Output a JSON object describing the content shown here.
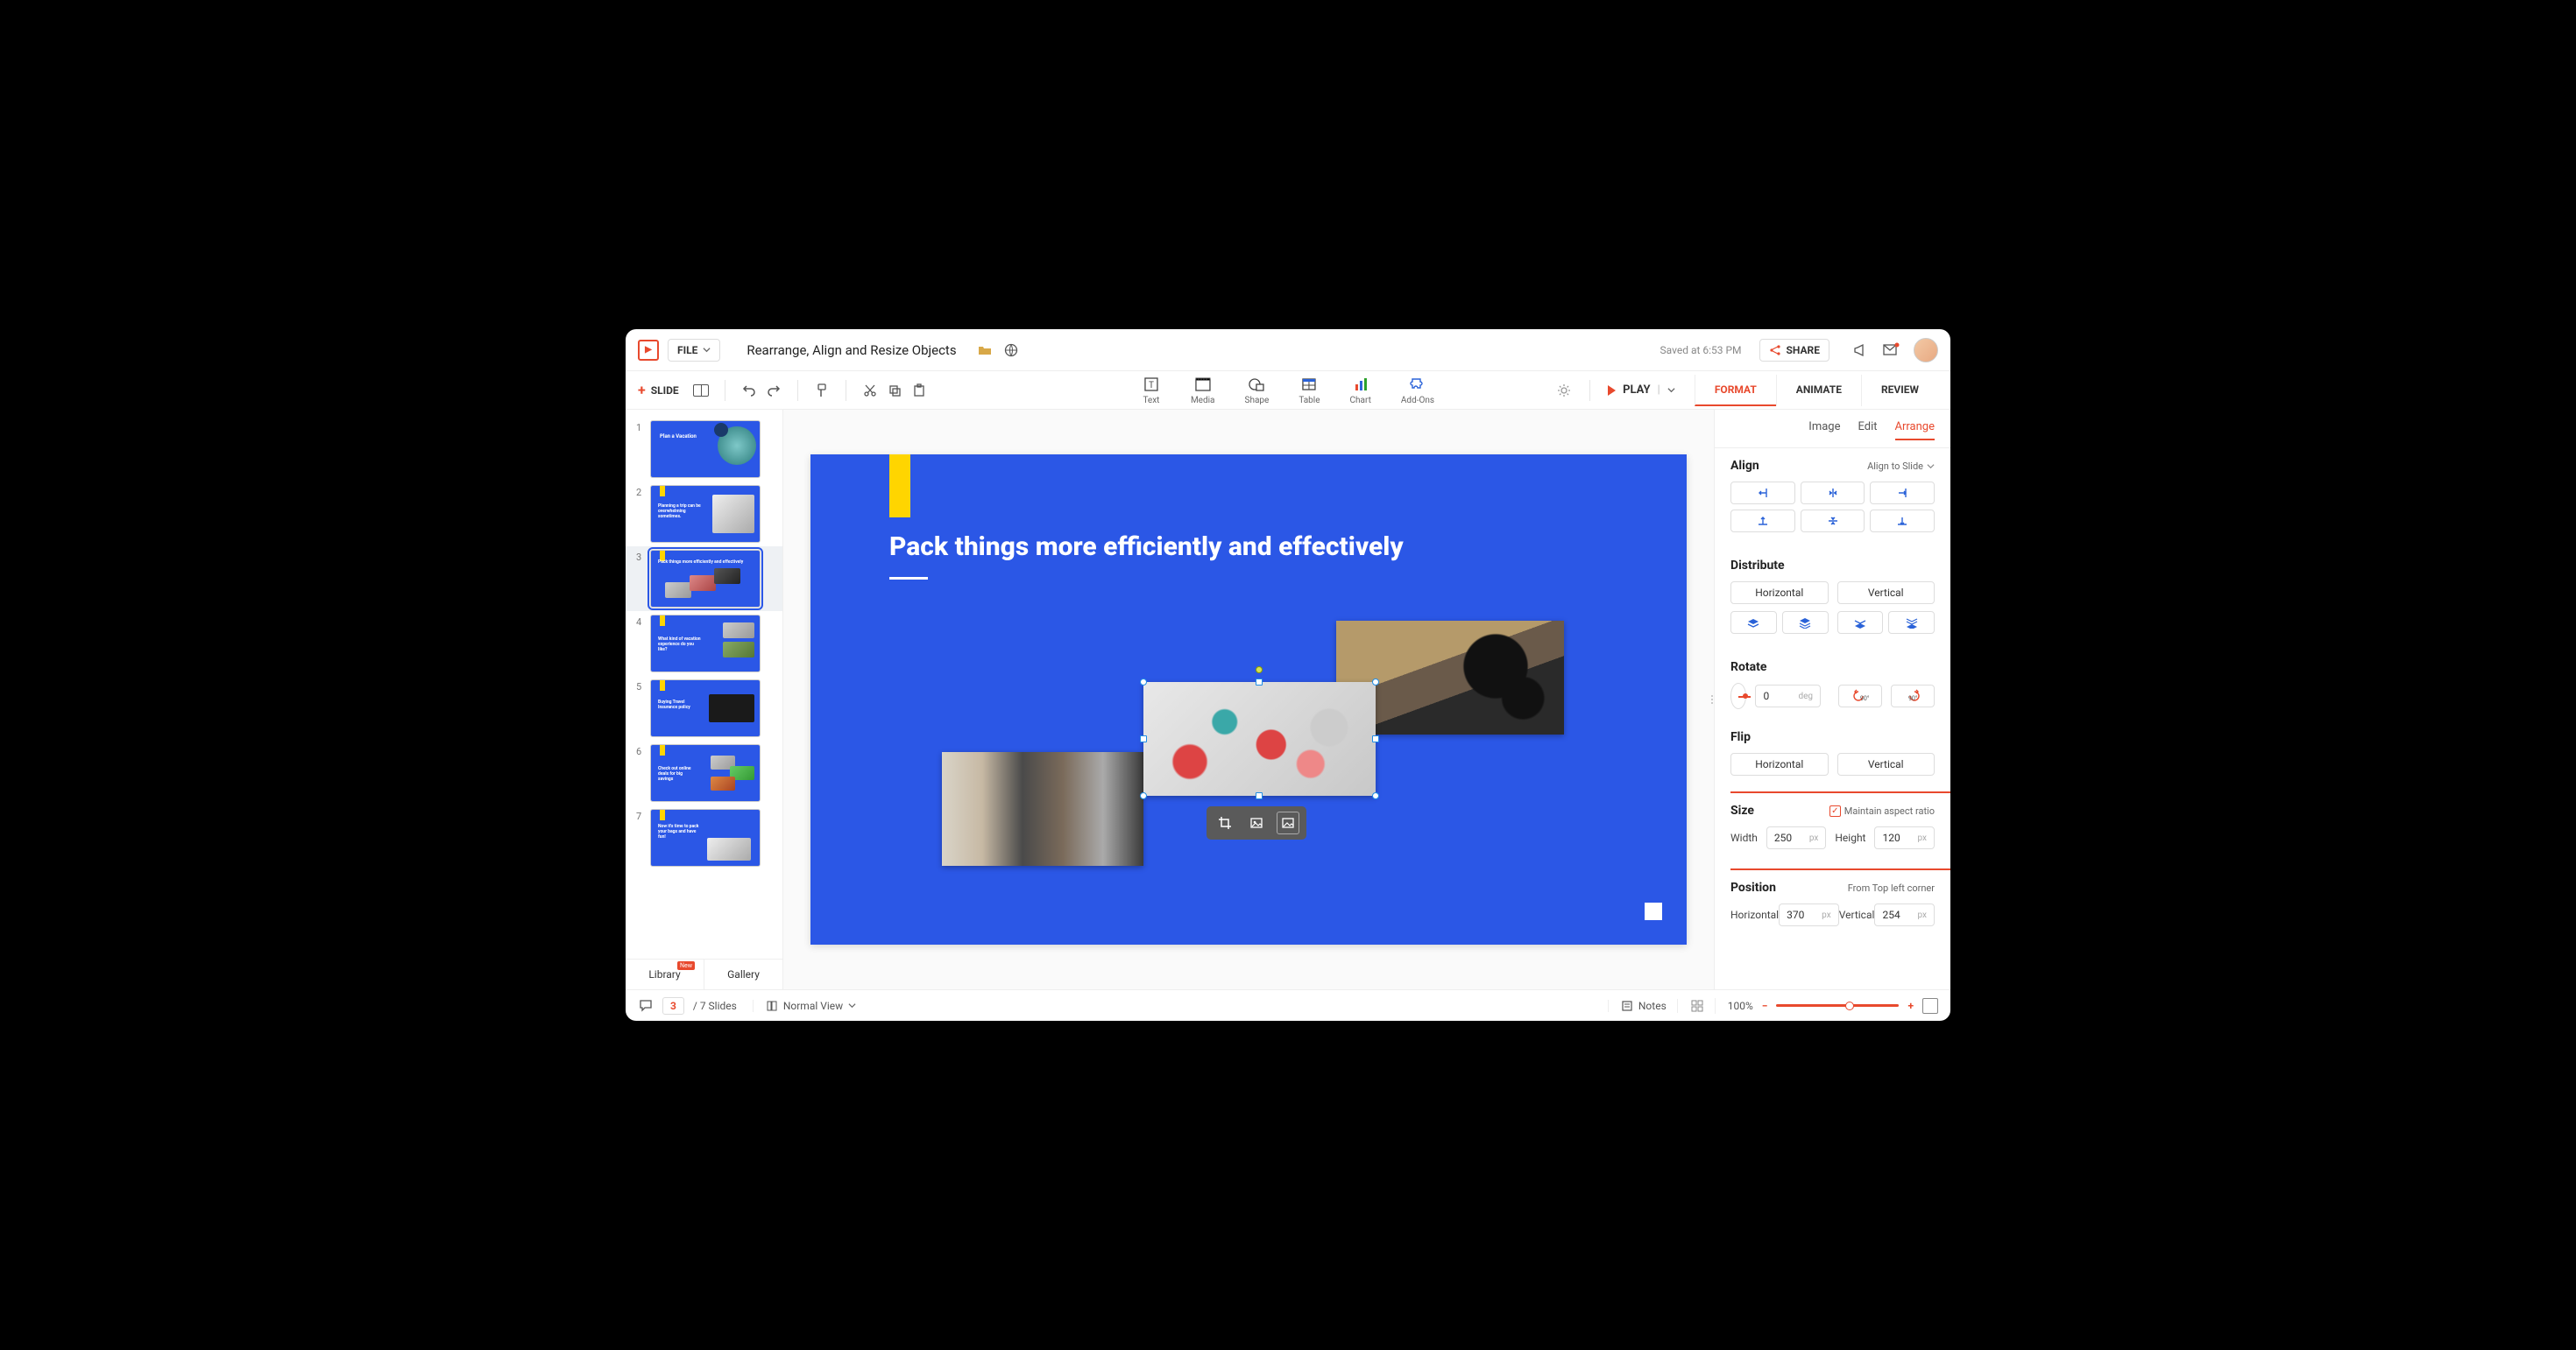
{
  "header": {
    "file_label": "FILE",
    "doc_title": "Rearrange, Align and Resize Objects",
    "saved_text": "Saved at 6:53 PM",
    "share_label": "SHARE"
  },
  "toolbar": {
    "add_slide_label": "SLIDE",
    "center_tools": [
      {
        "id": "text",
        "label": "Text"
      },
      {
        "id": "media",
        "label": "Media"
      },
      {
        "id": "shape",
        "label": "Shape"
      },
      {
        "id": "table",
        "label": "Table"
      },
      {
        "id": "chart",
        "label": "Chart"
      },
      {
        "id": "addons",
        "label": "Add-Ons"
      }
    ],
    "play_label": "PLAY",
    "panel_tabs": [
      {
        "id": "format",
        "label": "FORMAT",
        "active": true
      },
      {
        "id": "animate",
        "label": "ANIMATE",
        "active": false
      },
      {
        "id": "review",
        "label": "REVIEW",
        "active": false
      }
    ]
  },
  "thumbnails": {
    "count": 7,
    "selected_index": 3,
    "slides": [
      {
        "n": 1,
        "title": "Plan a Vacation"
      },
      {
        "n": 2,
        "title": "Planning a trip can be overwhelming sometimes."
      },
      {
        "n": 3,
        "title": "Pack things more efficiently and effectively"
      },
      {
        "n": 4,
        "title": "What kind of vacation experience do you like?"
      },
      {
        "n": 5,
        "title": "Buying Travel Insurance policy"
      },
      {
        "n": 6,
        "title": "Check out online deals for big savings"
      },
      {
        "n": 7,
        "title": "Now it's time to pack your bags and have fun!"
      }
    ],
    "footer_tabs": {
      "library": "Library",
      "library_badge": "New",
      "gallery": "Gallery"
    }
  },
  "slide": {
    "title": "Pack things more efficiently and effectively"
  },
  "format_panel": {
    "subtabs": [
      {
        "id": "image",
        "label": "Image",
        "active": false
      },
      {
        "id": "edit",
        "label": "Edit",
        "active": false
      },
      {
        "id": "arrange",
        "label": "Arrange",
        "active": true
      }
    ],
    "align": {
      "title": "Align",
      "mode": "Align to Slide"
    },
    "distribute": {
      "title": "Distribute",
      "horizontal": "Horizontal",
      "vertical": "Vertical"
    },
    "rotate": {
      "title": "Rotate",
      "value": "0",
      "unit": "deg",
      "cw": "90°",
      "ccw": "90°"
    },
    "flip": {
      "title": "Flip",
      "horizontal": "Horizontal",
      "vertical": "Vertical"
    },
    "size": {
      "title": "Size",
      "maintain": "Maintain aspect ratio",
      "width_label": "Width",
      "width": "250",
      "height_label": "Height",
      "height": "120",
      "unit": "px"
    },
    "position": {
      "title": "Position",
      "hint": "From Top left corner",
      "h_label": "Horizontal",
      "h": "370",
      "v_label": "Vertical",
      "v": "254",
      "unit": "px"
    }
  },
  "statusbar": {
    "current_slide": "3",
    "total_text": "/ 7 Slides",
    "view_mode": "Normal View",
    "notes": "Notes",
    "zoom": "100%"
  }
}
